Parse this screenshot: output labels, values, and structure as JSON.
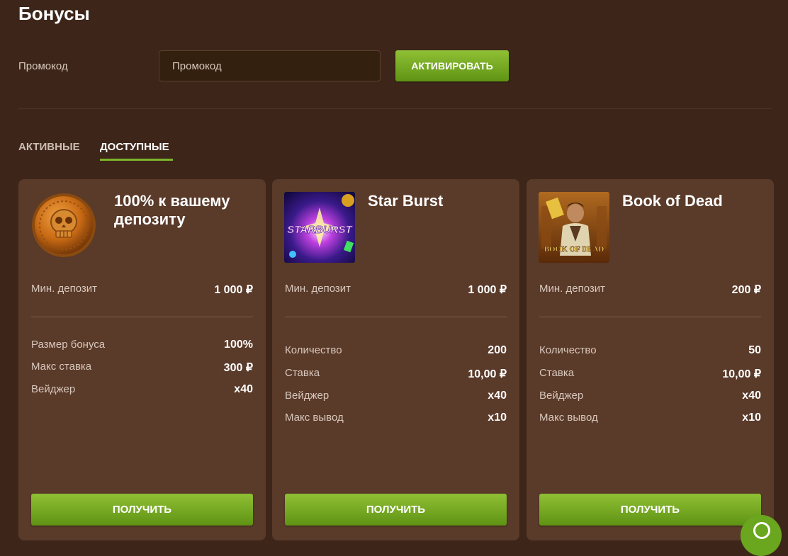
{
  "page": {
    "title": "Бонусы"
  },
  "promo": {
    "label": "Промокод",
    "placeholder": "Промокод",
    "activate_label": "АКТИВИРОВАТЬ"
  },
  "tabs": [
    {
      "label": "АКТИВНЫЕ",
      "active": false
    },
    {
      "label": "ДОСТУПНЫЕ",
      "active": true
    }
  ],
  "colors": {
    "background": "#3d2619",
    "card": "#5a3a29",
    "accent": "#7cb32a"
  },
  "cards": [
    {
      "title": "100% к вашему депозиту",
      "image": "skull-coin-icon",
      "min_deposit": {
        "label": "Мин. депозит",
        "value": "1 000 ₽"
      },
      "details": [
        {
          "label": "Размер бонуса",
          "value": "100%"
        },
        {
          "label": "Макс ставка",
          "value": "300 ₽"
        },
        {
          "label": "Вейджер",
          "value": "x40"
        }
      ],
      "button": "ПОЛУЧИТЬ"
    },
    {
      "title": "Star Burst",
      "image": "starburst-logo",
      "image_text": "STARBURST",
      "min_deposit": {
        "label": "Мин. депозит",
        "value": "1 000 ₽"
      },
      "details": [
        {
          "label": "Количество",
          "value": "200"
        },
        {
          "label": "Ставка",
          "value": "10,00 ₽"
        },
        {
          "label": "Вейджер",
          "value": "x40"
        },
        {
          "label": "Макс вывод",
          "value": "x10"
        }
      ],
      "button": "ПОЛУЧИТЬ"
    },
    {
      "title": "Book of Dead",
      "image": "book-of-dead-logo",
      "image_text": "BOOK OF DEAD",
      "min_deposit": {
        "label": "Мин. депозит",
        "value": "200 ₽"
      },
      "details": [
        {
          "label": "Количество",
          "value": "50"
        },
        {
          "label": "Ставка",
          "value": "10,00 ₽"
        },
        {
          "label": "Вейджер",
          "value": "x40"
        },
        {
          "label": "Макс вывод",
          "value": "x10"
        }
      ],
      "button": "ПОЛУЧИТЬ"
    }
  ],
  "help_button": {
    "icon": "chat-help-icon"
  }
}
